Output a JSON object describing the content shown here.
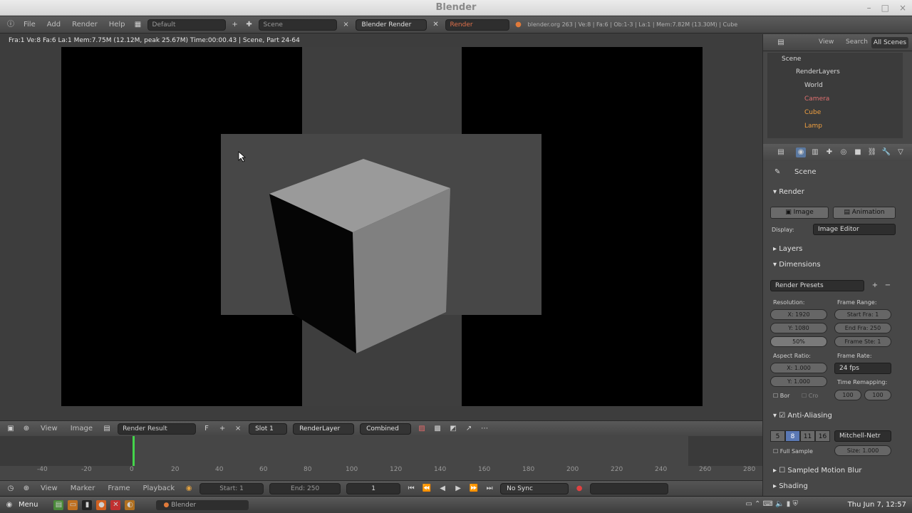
{
  "window": {
    "title": "Blender",
    "controls": [
      "–",
      "□",
      "×"
    ]
  },
  "topbar": {
    "menus": [
      "File",
      "Add",
      "Render",
      "Help"
    ],
    "layout_field": "Default",
    "scene_field": "Scene",
    "engine": "Blender Render",
    "render_field": "Render",
    "stats": "blender.org 263 | Ve:8 | Fa:6 | Ob:1-3 | La:1 | Mem:7.82M (13.30M) | Cube"
  },
  "viewport": {
    "info": "Fra:1  Ve:8 Fa:6 La:1 Mem:7.75M (12.12M, peak 25.67M) Time:00:00.43 | Scene, Part 24-64"
  },
  "image_header": {
    "menus": [
      "View",
      "Image"
    ],
    "image_name": "Render Result",
    "slot": "Slot 1",
    "layer": "RenderLayer",
    "pass": "Combined"
  },
  "timeline": {
    "ruler": [
      "-40",
      "-20",
      "0",
      "20",
      "40",
      "60",
      "80",
      "100",
      "120",
      "140",
      "160",
      "180",
      "200",
      "220",
      "240",
      "260",
      "280"
    ],
    "footer_menus": [
      "View",
      "Marker",
      "Frame",
      "Playback"
    ],
    "start": "Start: 1",
    "end": "End: 250",
    "current": "1",
    "sync": "No Sync"
  },
  "outliner": {
    "menus": [
      "View",
      "Search",
      "All Scenes"
    ],
    "items": [
      "Scene",
      "RenderLayers",
      "World",
      "Camera",
      "Cube",
      "Lamp"
    ]
  },
  "properties": {
    "context": "Scene",
    "render_panel": "Render",
    "image_btn": "Image",
    "animation_btn": "Animation",
    "display_label": "Display:",
    "display_value": "Image Editor",
    "layers_panel": "Layers",
    "dimensions_panel": "Dimensions",
    "presets": "Render Presets",
    "resolution_label": "Resolution:",
    "res_x": "X: 1920",
    "res_y": "Y: 1080",
    "res_pct": "50%",
    "frame_range_label": "Frame Range:",
    "start_frame": "Start Fra: 1",
    "end_frame": "End Fra: 250",
    "frame_step": "Frame Ste: 1",
    "aspect_label": "Aspect Ratio:",
    "aspect_x": "X: 1.000",
    "aspect_y": "Y: 1.000",
    "frame_rate_label": "Frame Rate:",
    "fps": "24 fps",
    "border_label": "Bor",
    "crop_label": "Cro",
    "time_remap_label": "Time Remapping:",
    "remap_old": "100",
    "remap_new": "100",
    "aa_panel": "Anti-Aliasing",
    "aa_samples": [
      "5",
      "8",
      "11",
      "16"
    ],
    "aa_filter": "Mitchell-Netr",
    "full_sample": "Full Sample",
    "aa_size": "Size: 1.000",
    "motion_blur_panel": "Sampled Motion Blur",
    "shading_panel": "Shading"
  },
  "taskbar": {
    "menu": "Menu",
    "app": "Blender",
    "clock": "Thu Jun  7, 12:57"
  }
}
